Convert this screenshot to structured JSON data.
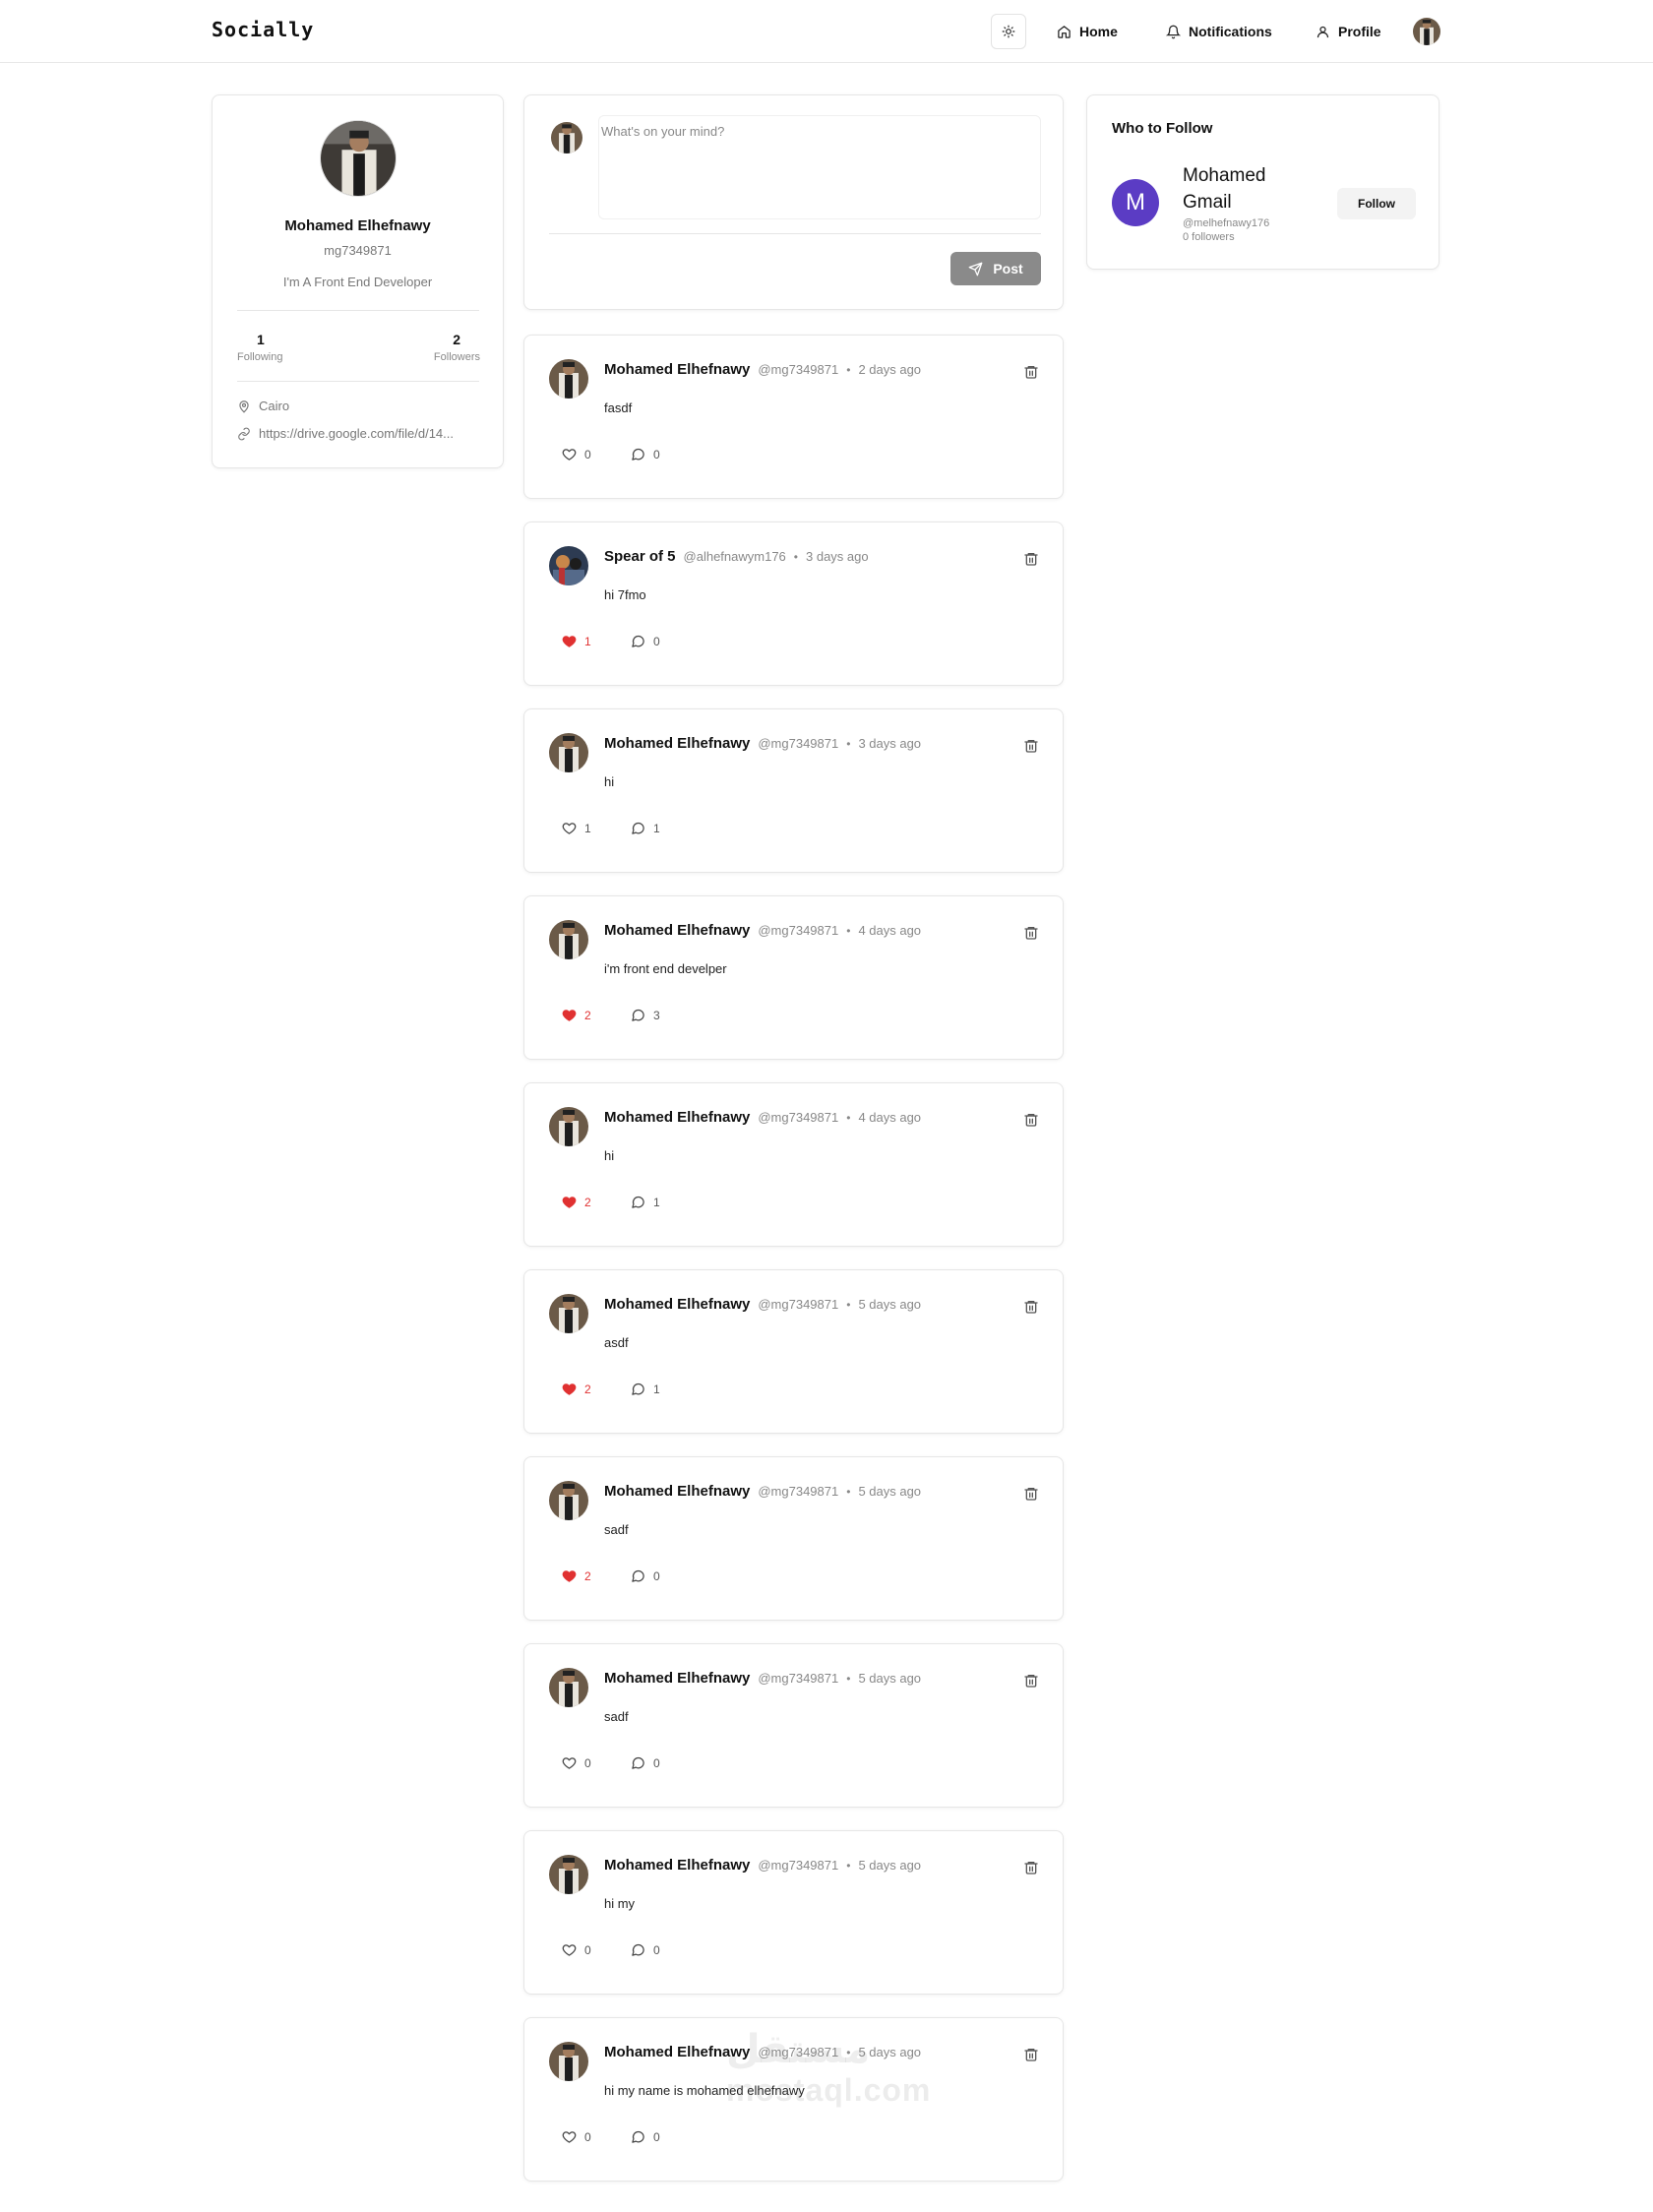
{
  "nav": {
    "logo": "Socially",
    "home": "Home",
    "notifications": "Notifications",
    "profile": "Profile"
  },
  "profile": {
    "name": "Mohamed Elhefnawy",
    "handle": "mg7349871",
    "bio": "I'm A Front End Developer",
    "following_count": "1",
    "following_label": "Following",
    "followers_count": "2",
    "followers_label": "Followers",
    "location": "Cairo",
    "website": "https://drive.google.com/file/d/14..."
  },
  "composer": {
    "placeholder": "What's on your mind?",
    "post_label": "Post"
  },
  "who_to_follow": {
    "title": "Who to Follow",
    "user": {
      "initial": "M",
      "name": "Mohamed Gmail",
      "handle": "@melhefnawy176",
      "followers": "0 followers",
      "button": "Follow"
    },
    "avatar_color": "#5b3cc4"
  },
  "posts": [
    {
      "name": "Mohamed Elhefnawy",
      "handle": "@mg7349871",
      "time": "2 days ago",
      "text": "fasdf",
      "likes": "0",
      "comments": "0",
      "liked": false
    },
    {
      "name": "Spear of 5",
      "handle": "@alhefnawym176",
      "time": "3 days ago",
      "text": "hi 7fmo",
      "likes": "1",
      "comments": "0",
      "liked": true
    },
    {
      "name": "Mohamed Elhefnawy",
      "handle": "@mg7349871",
      "time": "3 days ago",
      "text": "hi",
      "likes": "1",
      "comments": "1",
      "liked": false
    },
    {
      "name": "Mohamed Elhefnawy",
      "handle": "@mg7349871",
      "time": "4 days ago",
      "text": "i'm front end develper",
      "likes": "2",
      "comments": "3",
      "liked": true
    },
    {
      "name": "Mohamed Elhefnawy",
      "handle": "@mg7349871",
      "time": "4 days ago",
      "text": "hi",
      "likes": "2",
      "comments": "1",
      "liked": true
    },
    {
      "name": "Mohamed Elhefnawy",
      "handle": "@mg7349871",
      "time": "5 days ago",
      "text": "asdf",
      "likes": "2",
      "comments": "1",
      "liked": true
    },
    {
      "name": "Mohamed Elhefnawy",
      "handle": "@mg7349871",
      "time": "5 days ago",
      "text": "sadf",
      "likes": "2",
      "comments": "0",
      "liked": true
    },
    {
      "name": "Mohamed Elhefnawy",
      "handle": "@mg7349871",
      "time": "5 days ago",
      "text": "sadf",
      "likes": "0",
      "comments": "0",
      "liked": false
    },
    {
      "name": "Mohamed Elhefnawy",
      "handle": "@mg7349871",
      "time": "5 days ago",
      "text": "hi my",
      "likes": "0",
      "comments": "0",
      "liked": false
    },
    {
      "name": "Mohamed Elhefnawy",
      "handle": "@mg7349871",
      "time": "5 days ago",
      "text": "hi my name is mohamed elhefnawy",
      "likes": "0",
      "comments": "0",
      "liked": false
    }
  ],
  "watermark": {
    "arabic": "مستقل",
    "latin": "mostaql.com"
  },
  "colors": {
    "like_active": "#e03131",
    "post_button": "#8a8a8a"
  }
}
